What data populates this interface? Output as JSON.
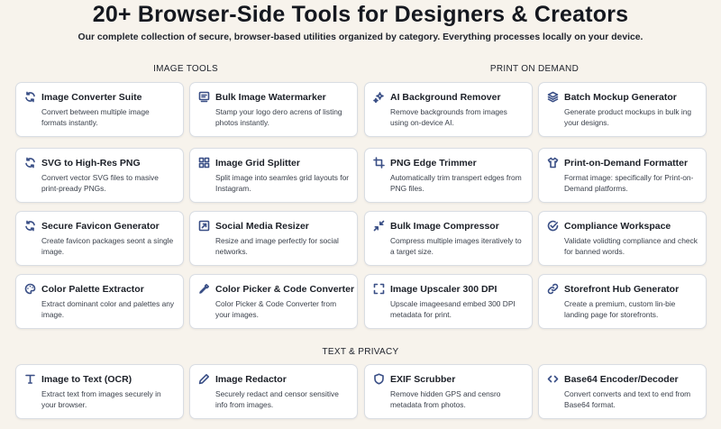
{
  "header": {
    "title": "20+ Browser-Side Tools for Designers & Creators",
    "subtitle": "Our complete collection of secure, browser-based utilities organized by category. Everything processes locally on your device."
  },
  "sections": {
    "image_tools": "IMAGE TOOLS",
    "print_on_demand": "PRINT ON DEMAND",
    "text_privacy": "TEXT & PRIVACY"
  },
  "cards": [
    {
      "title": "Image Converter Suite",
      "desc": "Convert between multiple image formats instantly.",
      "icon": "refresh-icon"
    },
    {
      "title": "Bulk Image Watermarker",
      "desc": "Stamp your logo dero acrens of listing photos instantly.",
      "icon": "stamp-icon"
    },
    {
      "title": "AI Background Remover",
      "desc": "Remove backgrounds from images using on-device AI.",
      "icon": "sparkles-icon"
    },
    {
      "title": "Batch Mockup Generator",
      "desc": "Generate product mockups in bulk ing your designs.",
      "icon": "layers-icon"
    },
    {
      "title": "SVG to High-Res PNG",
      "desc": "Convert vector SVG files to masive print-pready PNGs.",
      "icon": "refresh-icon"
    },
    {
      "title": "Image Grid Splitter",
      "desc": "Split image into seamles grid layouts for Instagram.",
      "icon": "grid-icon"
    },
    {
      "title": "PNG Edge Trimmer",
      "desc": "Automatically trim transpert edges from PNG files.",
      "icon": "crop-icon"
    },
    {
      "title": "Print-on-Demand Formatter",
      "desc": "Format image: specifically for Print-on-Demand platforms.",
      "icon": "shirt-icon"
    },
    {
      "title": "Secure Favicon Generator",
      "desc": "Create favicon packages seont a single image.",
      "icon": "refresh-icon"
    },
    {
      "title": "Social Media Resizer",
      "desc": "Resize and image perfectly for social networks.",
      "icon": "resize-icon"
    },
    {
      "title": "Bulk Image Compressor",
      "desc": "Compress multiple images iteratively to a target size.",
      "icon": "compress-icon"
    },
    {
      "title": "Compliance Workspace",
      "desc": "Validate volidting compliance and check for banned words.",
      "icon": "check-circle-icon"
    },
    {
      "title": "Color Palette Extractor",
      "desc": "Extract dominant color and palettes any image.",
      "icon": "palette-icon"
    },
    {
      "title": "Color Picker & Code Converter",
      "desc": "Color Picker & Code Converter from your images.",
      "icon": "eyedropper-icon"
    },
    {
      "title": "Image Upscaler 300 DPI",
      "desc": "Upscale imageesand embed 300 DPI metadata for print.",
      "icon": "expand-icon"
    },
    {
      "title": "Storefront Hub Generator",
      "desc": "Create a premium, custom lin-bie landing page for storefronts.",
      "icon": "link-icon"
    },
    {
      "title": "Image to Text (OCR)",
      "desc": "Extract text from images securely in your browser.",
      "icon": "text-icon"
    },
    {
      "title": "Image Redactor",
      "desc": "Securely redact and censor sensitive info from images.",
      "icon": "pencil-icon"
    },
    {
      "title": "EXIF Scrubber",
      "desc": "Remove hidden GPS and censro metadata from photos.",
      "icon": "shield-icon"
    },
    {
      "title": "Base64 Encoder/Decoder",
      "desc": "Convert converts and text to end from Base64 format.",
      "icon": "code-icon"
    }
  ]
}
